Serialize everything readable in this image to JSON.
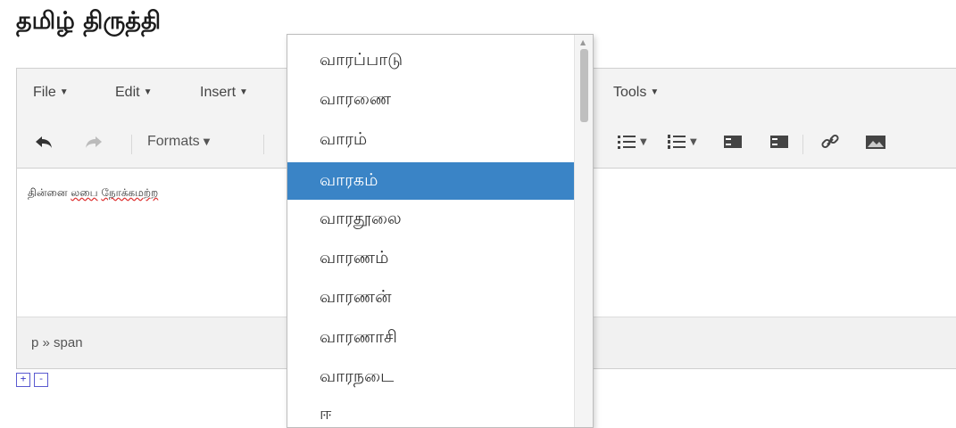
{
  "page": {
    "title": "தமிழ் திருத்தி"
  },
  "menubar": {
    "items": [
      {
        "label": "File"
      },
      {
        "label": "Edit"
      },
      {
        "label": "Insert"
      },
      {
        "label": "Tools"
      }
    ]
  },
  "toolbar": {
    "formats_label": "Formats",
    "icons": [
      "undo-icon",
      "redo-icon",
      "bullet-list-icon",
      "numbered-list-icon",
      "outdent-icon",
      "indent-icon",
      "link-icon",
      "image-icon"
    ]
  },
  "editor": {
    "content_words": [
      "தின்னை",
      "லபை",
      "நோக்கமற்ற"
    ]
  },
  "statusbar": {
    "path": "p » span"
  },
  "zoom": {
    "plus": "+",
    "minus": "-"
  },
  "dropdown": {
    "items": [
      {
        "label": "வாரப்பாடு"
      },
      {
        "label": "வாரணை"
      },
      {
        "label": "வாரம்"
      },
      {
        "label": "வாரகம்",
        "selected": true
      },
      {
        "label": "வாரதூலை"
      },
      {
        "label": "வாரணம்"
      },
      {
        "label": "வாரணன்"
      },
      {
        "label": "வாரணாசி"
      },
      {
        "label": "வாரநடை"
      },
      {
        "label": "ஈ"
      }
    ],
    "selected_color": "#3a84c6"
  }
}
